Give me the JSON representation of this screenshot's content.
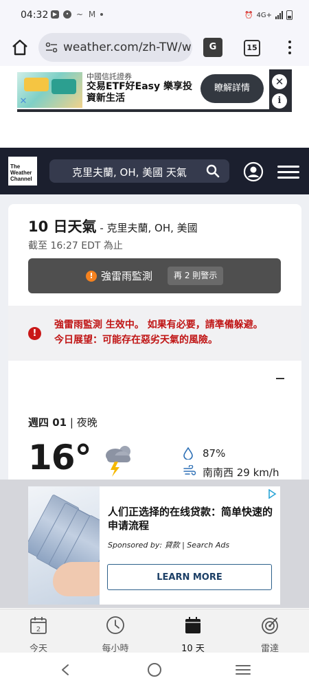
{
  "status_bar": {
    "time": "04:32",
    "network": "4G+"
  },
  "browser": {
    "url": "weather.com/zh-TW/w",
    "tab_count": "15"
  },
  "top_ad": {
    "brand": "中國信託證券",
    "title": "交易ETF好Easy 樂享投資新生活",
    "cta": "瞭解詳情"
  },
  "site_header": {
    "logo_line1": "The",
    "logo_line2": "Weather",
    "logo_line3": "Channel",
    "search_text": "克里夫蘭, OH, 美國 天氣"
  },
  "forecast": {
    "title": "10 日天氣",
    "location": " - 克里夫蘭, OH, 美國",
    "updated": "截至 16:27 EDT 為止",
    "alert_label": "強雷雨監測",
    "alert_more": "再 2 則警示",
    "warning_text": "強雷雨監測 生效中。 如果有必要，請準備躲避。 今日展望：可能存在惡劣天氣的風險。",
    "day": "週四 01",
    "period": " | 夜晚",
    "temperature": "16°",
    "humidity": "87%",
    "wind": "南南西 29 km/h"
  },
  "bottom_ad": {
    "title": "人们正选择的在线贷款：简单快速的申请流程",
    "sponsor": "Sponsored by: 貸款 | Search Ads",
    "cta": "LEARN MORE"
  },
  "bottom_nav": {
    "items": [
      {
        "label": "今天",
        "badge": "2"
      },
      {
        "label": "每小時"
      },
      {
        "label": "10 天"
      },
      {
        "label": "雷達"
      }
    ]
  },
  "colors": {
    "header_bg": "#1b1f2e",
    "alert_orange": "#f5821f",
    "warning_red": "#c01515",
    "lightning_yellow": "#f5b800"
  }
}
